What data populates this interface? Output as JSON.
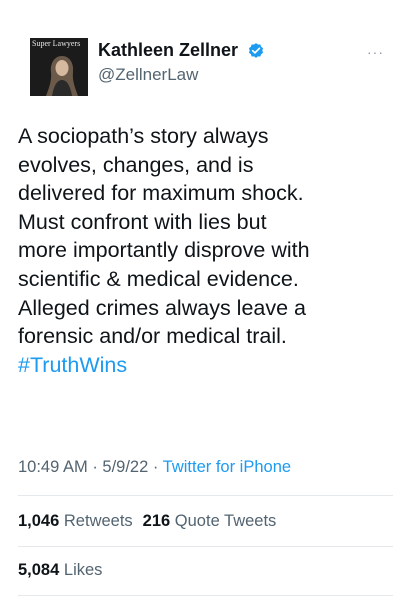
{
  "author": {
    "display_name": "Kathleen Zellner",
    "handle": "@ZellnerLaw",
    "avatar_text": "Super Lawyers",
    "verified_icon": "verified-badge-icon",
    "brand_color": "#1d9bf0"
  },
  "more_menu": {
    "label": "···"
  },
  "tweet": {
    "text_lines": [
      "A sociopath’s story always",
      "evolves, changes, and is",
      "delivered for maximum shock.",
      "Must confront with lies but",
      "more importantly disprove with",
      "scientific & medical evidence.",
      "Alleged crimes always  leave a",
      "forensic and/or medical trail."
    ],
    "hashtag": "#TruthWins"
  },
  "meta": {
    "time": "10:49 AM",
    "separator": "·",
    "date": "5/9/22",
    "source": "Twitter for iPhone"
  },
  "stats": {
    "retweets_count": "1,046",
    "retweets_label": "Retweets",
    "quotes_count": "216",
    "quotes_label": "Quote Tweets",
    "likes_count": "5,084",
    "likes_label": "Likes"
  }
}
